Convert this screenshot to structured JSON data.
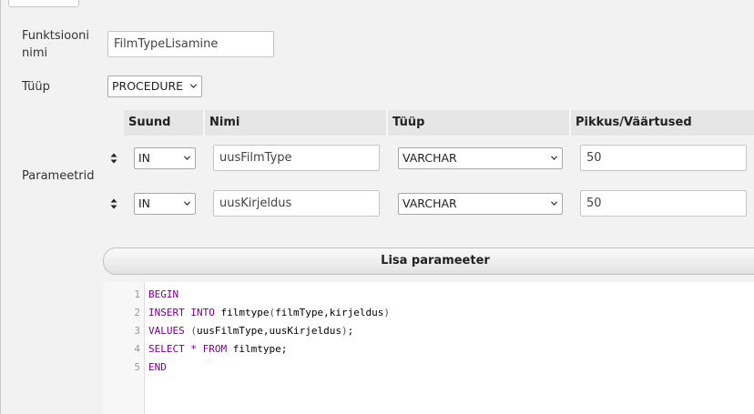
{
  "form": {
    "function_name_label": "Funktsiooni\nnimi",
    "function_name_value": "FilmTypeLisamine",
    "type_label": "Tüüp",
    "type_value": "PROCEDURE",
    "params_label": "Parameetrid"
  },
  "params_table": {
    "headers": [
      "Suund",
      "Nimi",
      "Tüüp",
      "Pikkus/Väärtused"
    ],
    "rows": [
      {
        "direction": "IN",
        "name": "uusFilmType",
        "type": "VARCHAR",
        "length": "50"
      },
      {
        "direction": "IN",
        "name": "uusKirjeldus",
        "type": "VARCHAR",
        "length": "50"
      }
    ]
  },
  "add_param_label": "Lisa parameeter",
  "editor": {
    "line_numbers": [
      "1",
      "2",
      "3",
      "4",
      "5"
    ],
    "lines": [
      [
        {
          "t": "BEGIN",
          "c": "kw"
        }
      ],
      [
        {
          "t": "INSERT",
          "c": "kw"
        },
        {
          "t": " ",
          "c": ""
        },
        {
          "t": "INTO",
          "c": "kw"
        },
        {
          "t": " filmtype",
          "c": ""
        },
        {
          "t": "(",
          "c": "pn"
        },
        {
          "t": "filmType,kirjeldus",
          "c": ""
        },
        {
          "t": ")",
          "c": "pn"
        }
      ],
      [
        {
          "t": "VALUES",
          "c": "kw"
        },
        {
          "t": " ",
          "c": ""
        },
        {
          "t": "(",
          "c": "pn"
        },
        {
          "t": "uusFilmType,uusKirjeldus",
          "c": ""
        },
        {
          "t": ")",
          "c": "pn"
        },
        {
          "t": ";",
          "c": ""
        }
      ],
      [
        {
          "t": "SELECT",
          "c": "kw"
        },
        {
          "t": " ",
          "c": ""
        },
        {
          "t": "*",
          "c": "kw"
        },
        {
          "t": " ",
          "c": ""
        },
        {
          "t": "FROM",
          "c": "kw"
        },
        {
          "t": " filmtype;",
          "c": ""
        }
      ],
      [
        {
          "t": "END",
          "c": "kw"
        }
      ]
    ]
  },
  "icons": {
    "dropdown": "chevron-down-icon",
    "row_handle": "drag-handle-icon"
  }
}
